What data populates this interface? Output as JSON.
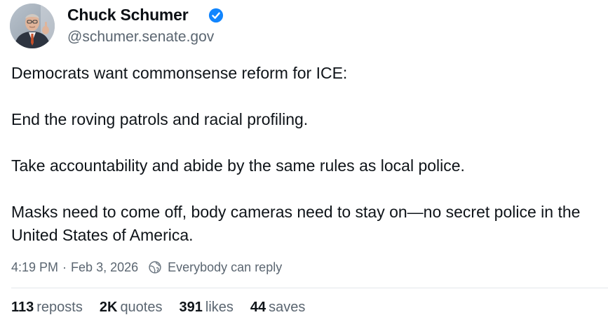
{
  "author": {
    "display_name": "Chuck Schumer",
    "handle": "@schumer.senate.gov",
    "verified_icon": "verified-badge-icon",
    "accent_color": "#1185fe"
  },
  "post": {
    "paragraphs": [
      "Democrats want commonsense reform for ICE:",
      "End the roving patrols and racial profiling.",
      "Take accountability and abide by the same rules as local police.",
      "Masks need to come off, body cameras need to stay on—no secret police in the United States of America."
    ]
  },
  "meta": {
    "time": "4:19 PM",
    "separator": "·",
    "date": "Feb 3, 2026",
    "reply_setting": "Everybody can reply",
    "reply_icon": "globe-icon"
  },
  "stats": {
    "reposts": {
      "count": "113",
      "label": "reposts"
    },
    "quotes": {
      "count": "2K",
      "label": "quotes"
    },
    "likes": {
      "count": "391",
      "label": "likes"
    },
    "saves": {
      "count": "44",
      "label": "saves"
    }
  }
}
